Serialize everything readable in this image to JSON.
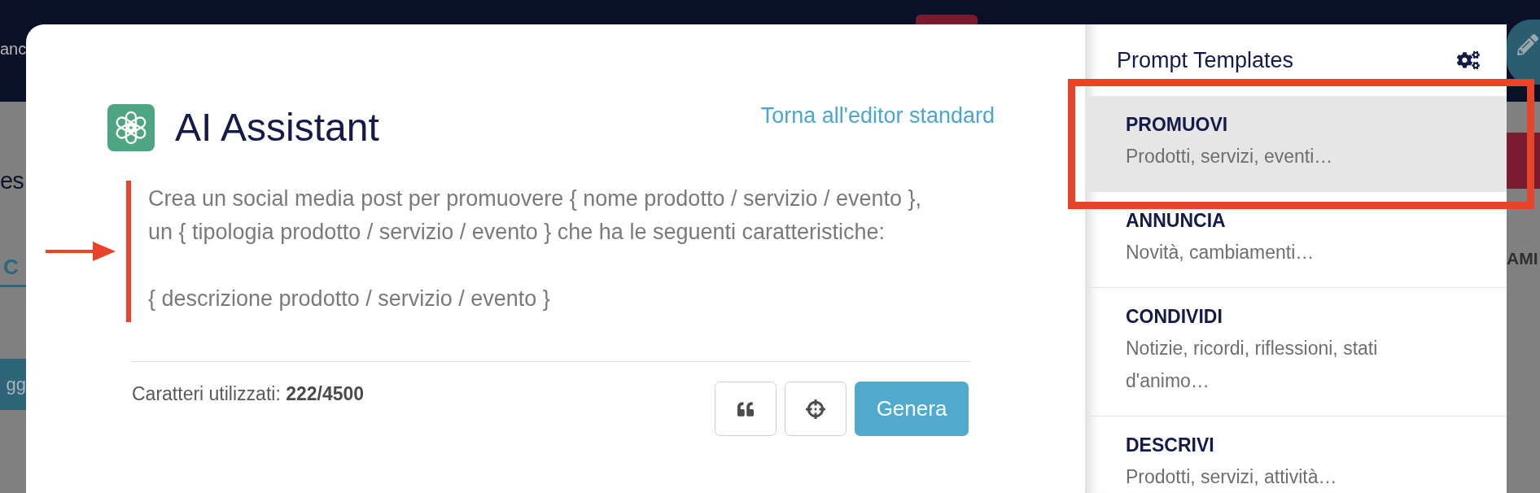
{
  "background": {
    "left": [
      {
        "kind": "nav_text",
        "text": "anc"
      },
      {
        "kind": "heading",
        "text": "es"
      },
      {
        "kind": "tab",
        "text": "C"
      },
      {
        "kind": "button",
        "text": "gg"
      }
    ],
    "right": [
      {
        "kind": "edit_button"
      },
      {
        "kind": "button"
      },
      {
        "kind": "label",
        "text": "AMI"
      }
    ]
  },
  "modal": {
    "title": "AI Assistant",
    "back_link": "Torna all'editor standard",
    "prompt_text": "Crea un social media post per promuovere { nome prodotto / servizio / evento },\nun { tipologia prodotto / servizio / evento } che ha le seguenti caratteristiche:\n\n{ descrizione prodotto / servizio / evento }",
    "char_count": "Caratteri utilizzati: **222/4500**",
    "buttons": [
      {
        "kind": "quote"
      },
      {
        "kind": "target"
      },
      {
        "kind": "primary",
        "label": "Genera"
      }
    ]
  },
  "templates": {
    "title": "Prompt Templates",
    "items": [
      {
        "name": "PROMUOVI",
        "description": "Prodotti, servizi, eventi…",
        "selected": true
      },
      {
        "name": "ANNUNCIA",
        "description": "Novità, cambiamenti…",
        "selected": false
      },
      {
        "name": "CONDIVIDI",
        "description": "Notizie, ricordi, riflessioni, stati d'animo…",
        "selected": false
      },
      {
        "name": "DESCRIVI",
        "description": "Prodotti, servizi, attività…",
        "selected": false
      }
    ]
  },
  "annotations": [
    {
      "kind": "arrow"
    },
    {
      "kind": "bar"
    },
    {
      "kind": "frame"
    }
  ]
}
